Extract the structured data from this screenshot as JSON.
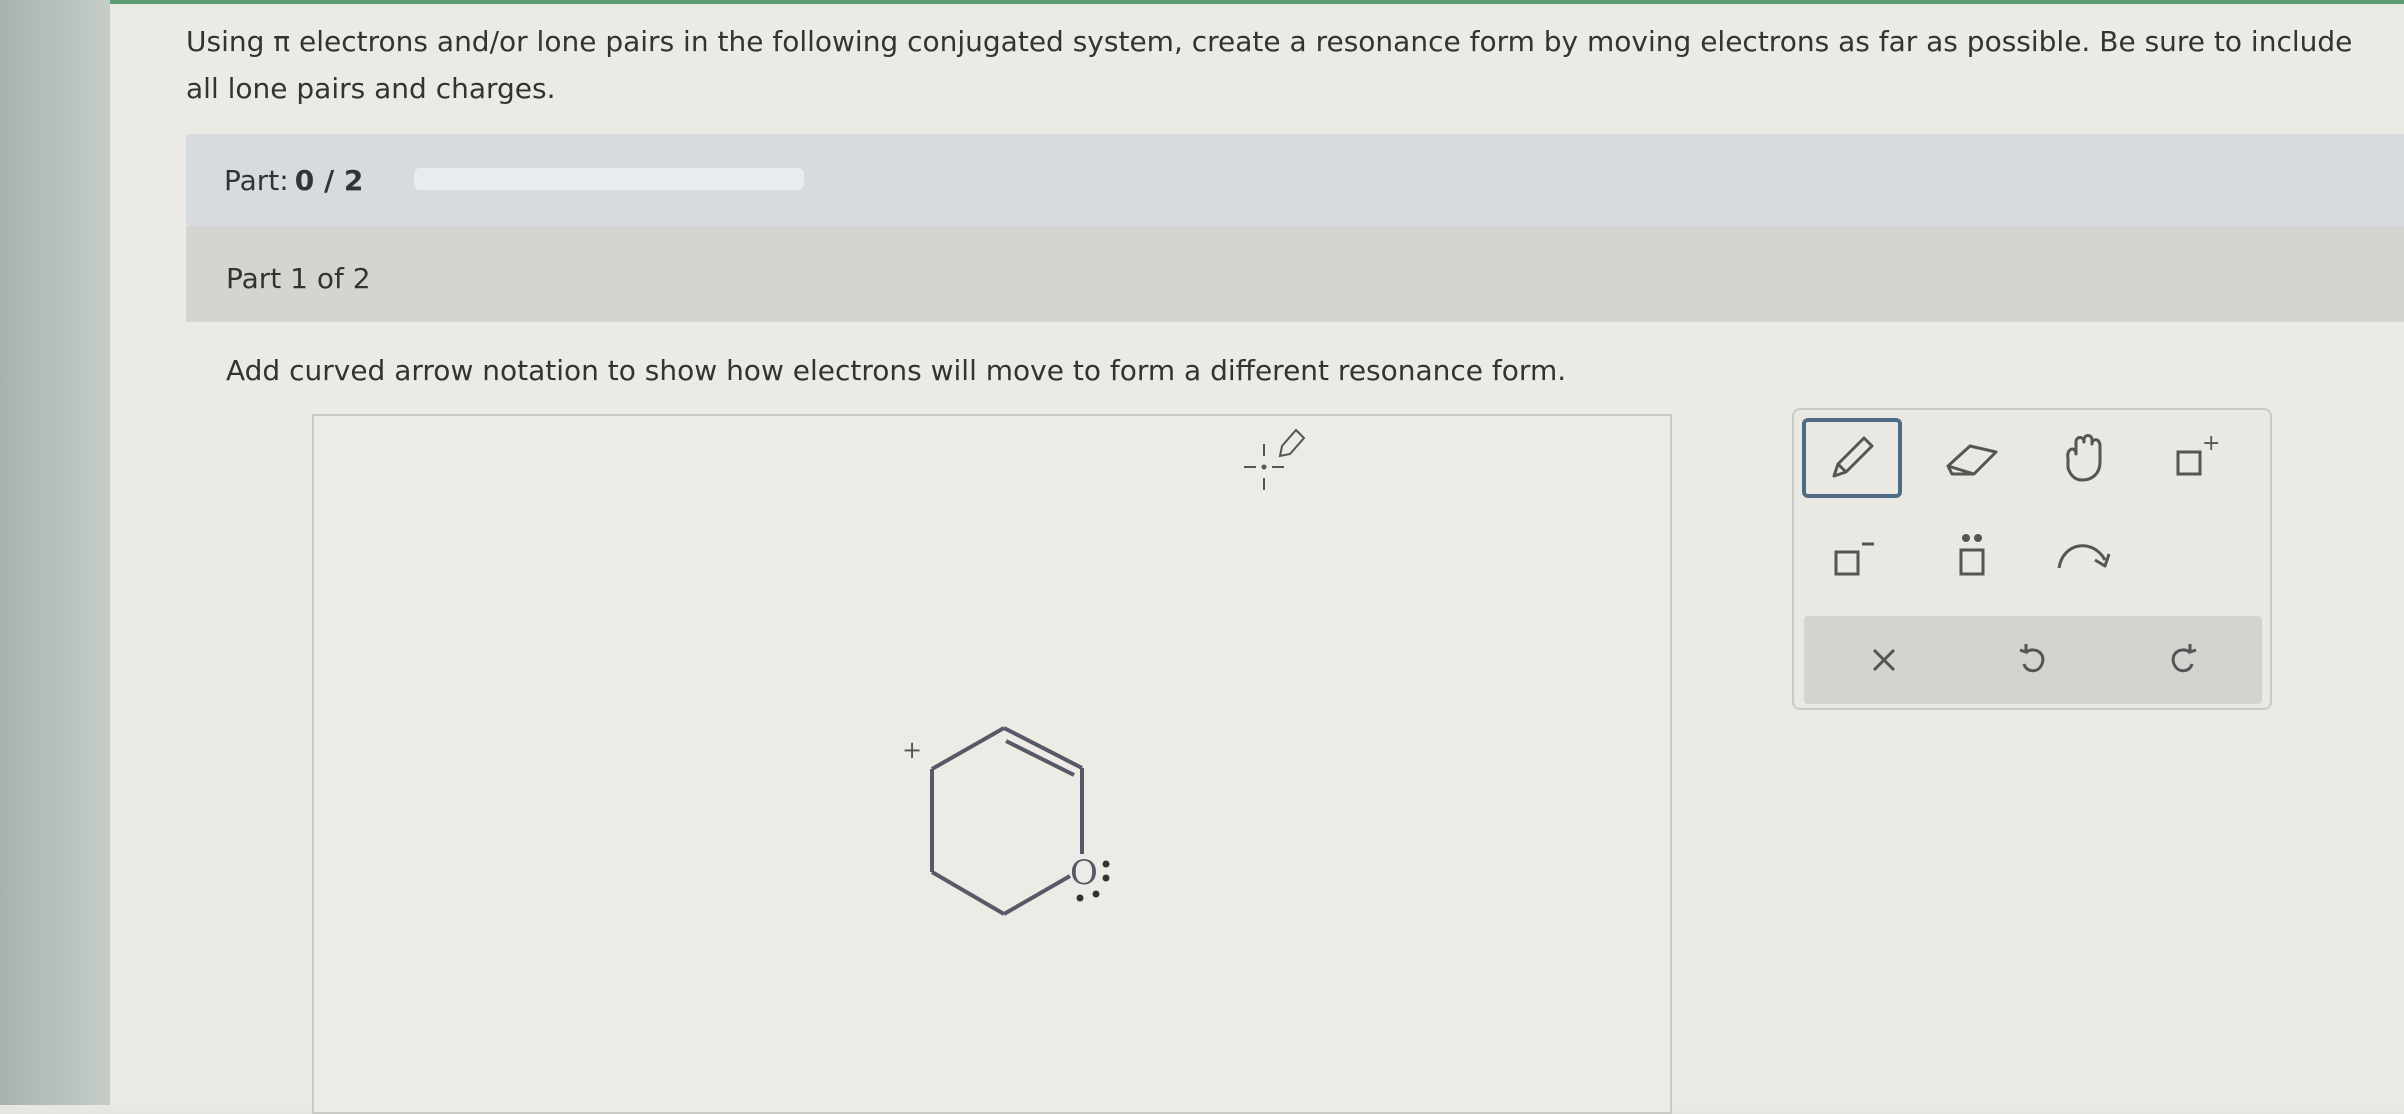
{
  "question": {
    "text": "Using π electrons and/or lone pairs in the following conjugated system, create a resonance form by moving electrons as far as possible. Be sure to include all lone pairs and charges."
  },
  "progress": {
    "prefix": "Part:",
    "value": "0 / 2",
    "fraction": 0
  },
  "part": {
    "header": "Part 1 of 2",
    "instruction": "Add curved arrow notation to show how electrons will move to form a different resonance form."
  },
  "molecule": {
    "oxygen_label": "O",
    "charge_label": "+"
  },
  "toolbox": {
    "tools": [
      {
        "name": "pencil-icon",
        "active": true
      },
      {
        "name": "eraser-icon",
        "active": false
      },
      {
        "name": "hand-icon",
        "active": false
      },
      {
        "name": "positive-charge-icon",
        "active": false
      },
      {
        "name": "negative-charge-icon",
        "active": false
      },
      {
        "name": "lone-pair-icon",
        "active": false
      },
      {
        "name": "curved-arrow-icon",
        "active": false
      }
    ],
    "footer": [
      "clear-icon",
      "undo-icon",
      "redo-icon"
    ],
    "charge_plus": "+",
    "charge_minus": "−"
  }
}
